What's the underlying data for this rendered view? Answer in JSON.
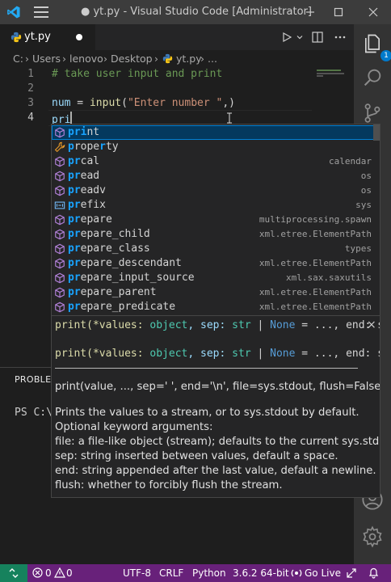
{
  "window": {
    "title": "● yt.py - Visual Studio Code [Administrator]"
  },
  "tab": {
    "name": "yt.py"
  },
  "breadcrumb": [
    "C:",
    "Users",
    "lenovo",
    "Desktop",
    "yt.py",
    "..."
  ],
  "editor": {
    "line_numbers": [
      "1",
      "2",
      "3",
      "4"
    ],
    "lines": {
      "l1": "# take user input and print",
      "l3_var": "num",
      "l3_eq": " = ",
      "l3_fn": "input",
      "l3_open": "(",
      "l3_str": "\"Enter number \"",
      "l3_close": ",)",
      "l4": "pri"
    }
  },
  "suggestions": [
    {
      "match": "pri",
      "rest": "nt",
      "detail": "",
      "kind": "cube"
    },
    {
      "match": "p",
      "rest": "rope",
      "match2": "r",
      "rest2": "ty",
      "detail": "",
      "kind": "wrench"
    },
    {
      "match": "pr",
      "rest": "cal",
      "detail": "calendar",
      "kind": "cube"
    },
    {
      "match": "pr",
      "rest": "ead",
      "detail": "os",
      "kind": "cube"
    },
    {
      "match": "pr",
      "rest": "eadv",
      "detail": "os",
      "kind": "cube"
    },
    {
      "match": "pr",
      "rest": "efix",
      "detail": "sys",
      "kind": "field"
    },
    {
      "match": "pr",
      "rest": "epare",
      "detail": "multiprocessing.spawn",
      "kind": "cube"
    },
    {
      "match": "pr",
      "rest": "epare_child",
      "detail": "xml.etree.ElementPath",
      "kind": "cube"
    },
    {
      "match": "pr",
      "rest": "epare_class",
      "detail": "types",
      "kind": "cube"
    },
    {
      "match": "pr",
      "rest": "epare_descendant",
      "detail": "xml.etree.ElementPath",
      "kind": "cube"
    },
    {
      "match": "pr",
      "rest": "epare_input_source",
      "detail": "xml.sax.saxutils",
      "kind": "cube"
    },
    {
      "match": "pr",
      "rest": "epare_parent",
      "detail": "xml.etree.ElementPath",
      "kind": "cube"
    },
    {
      "match": "pr",
      "rest": "epare_predicate",
      "detail": "xml.etree.ElementPath",
      "kind": "cube"
    }
  ],
  "hover": {
    "sig1_a": "print(*values: ",
    "sig1_b": "object",
    "sig1_c": ", sep: ",
    "sig1_d": "str",
    "sig1_e": " | ",
    "sig1_f": "None",
    "sig1_g": " = ..., end: s",
    "sig2_a": "print(*values: ",
    "sig2_b": "object",
    "sig2_c": ", sep: ",
    "sig2_d": "str",
    "sig2_e": " | ",
    "sig2_f": "None",
    "sig2_g": " = ..., end: s",
    "close": "×",
    "doc": [
      "print(value, ..., sep=' ', end='\\n', file=sys.stdout, flush=False)",
      "Prints the values to a stream, or to sys.stdout by default.",
      "Optional keyword arguments:",
      "file: a file-like object (stream); defaults to the current sys.stdout.",
      "sep: string inserted between values, default a space.",
      "end: string appended after the last value, default a newline.",
      "flush: whether to forcibly flush the stream."
    ]
  },
  "panel": {
    "tab_label": "PROBLEM",
    "terminal_line": "PS C:\\U"
  },
  "activity": {
    "badge": "1"
  },
  "status": {
    "errors": "0",
    "warnings": "0",
    "encoding": "UTF-8",
    "eol": "CRLF",
    "language": "Python",
    "interpreter": "3.6.2 64-bit",
    "golive": "Go Live"
  },
  "colors": {
    "status_bar": "#68217a",
    "remote": "#16825d",
    "selection": "#04395e",
    "match": "#18a3ff",
    "accent": "#007acc"
  }
}
